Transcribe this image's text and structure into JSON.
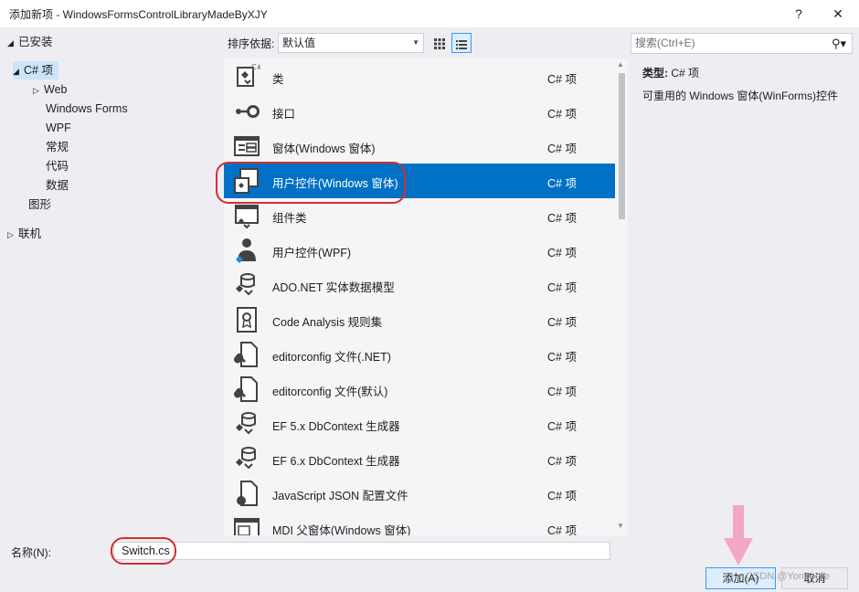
{
  "window": {
    "title": "添加新项 - WindowsFormsControlLibraryMadeByXJY",
    "help_glyph": "?",
    "close_glyph": "✕"
  },
  "tree": {
    "installed": "已安装",
    "csharp": "C# 项",
    "web": "Web",
    "winforms": "Windows Forms",
    "wpf": "WPF",
    "general": "常规",
    "code": "代码",
    "data": "数据",
    "graphics": "图形",
    "online": "联机"
  },
  "sort": {
    "label": "排序依据:",
    "value": "默认值"
  },
  "search": {
    "placeholder": "搜索(Ctrl+E)"
  },
  "items": [
    {
      "name": "类",
      "type": "C# 项",
      "icon": "class-icon"
    },
    {
      "name": "接口",
      "type": "C# 项",
      "icon": "interface-icon"
    },
    {
      "name": "窗体(Windows 窗体)",
      "type": "C# 项",
      "icon": "form-icon"
    },
    {
      "name": "用户控件(Windows 窗体)",
      "type": "C# 项",
      "icon": "user-control-icon"
    },
    {
      "name": "组件类",
      "type": "C# 项",
      "icon": "component-icon"
    },
    {
      "name": "用户控件(WPF)",
      "type": "C# 项",
      "icon": "wpf-user-control-icon"
    },
    {
      "name": "ADO.NET 实体数据模型",
      "type": "C# 项",
      "icon": "entity-model-icon"
    },
    {
      "name": "Code Analysis 规则集",
      "type": "C# 项",
      "icon": "ruleset-icon"
    },
    {
      "name": "editorconfig 文件(.NET)",
      "type": "C# 项",
      "icon": "editorconfig-icon"
    },
    {
      "name": "editorconfig 文件(默认)",
      "type": "C# 项",
      "icon": "editorconfig-icon"
    },
    {
      "name": "EF 5.x DbContext 生成器",
      "type": "C# 项",
      "icon": "dbcontext-icon"
    },
    {
      "name": "EF 6.x DbContext 生成器",
      "type": "C# 项",
      "icon": "dbcontext-icon"
    },
    {
      "name": "JavaScript JSON 配置文件",
      "type": "C# 项",
      "icon": "json-icon"
    },
    {
      "name": "MDI 父窗体(Windows 窗体)",
      "type": "C# 项",
      "icon": "mdi-form-icon"
    }
  ],
  "selected_index": 3,
  "detail": {
    "type_label": "类型:",
    "type_value": "C# 项",
    "description": "可重用的 Windows 窗体(WinForms)控件"
  },
  "bottom": {
    "name_label": "名称(N):",
    "name_value": "Switch.cs",
    "add_label": "添加(A)",
    "cancel_label": "取消"
  },
  "watermark": "CSDN @Yonbbgre",
  "colors": {
    "selection": "#0071c5",
    "annotation_ring": "#d32f2f",
    "annotation_arrow": "#f4a6c6"
  }
}
